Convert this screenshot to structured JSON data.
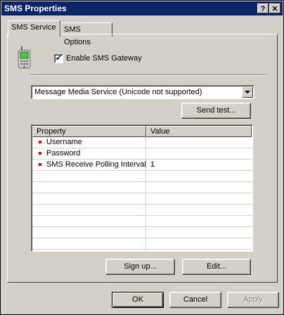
{
  "window": {
    "title": "SMS Properties",
    "help_label": "?",
    "close_label": "✕"
  },
  "tabs": [
    {
      "label": "SMS Service",
      "active": true
    },
    {
      "label": "SMS Options",
      "active": false
    }
  ],
  "gateway": {
    "enable_label": "Enable SMS Gateway",
    "checked": true,
    "check_glyph": "✔",
    "icon": "mobile-phone-icon"
  },
  "service": {
    "selected": "Message Media Service (Unicode not supported)"
  },
  "buttons": {
    "send_test": "Send test...",
    "sign_up": "Sign up...",
    "edit": "Edit...",
    "ok": "OK",
    "cancel": "Cancel",
    "apply": "Apply"
  },
  "properties": {
    "headers": {
      "property": "Property",
      "value": "Value"
    },
    "rows": [
      {
        "property": "Username",
        "value": ""
      },
      {
        "property": "Password",
        "value": ""
      },
      {
        "property": "SMS Receive Polling Interval",
        "value": "1"
      }
    ]
  },
  "colors": {
    "titlebar": "#0a246a",
    "bullet": "#e00000",
    "dialog": "#d4d0c8"
  }
}
